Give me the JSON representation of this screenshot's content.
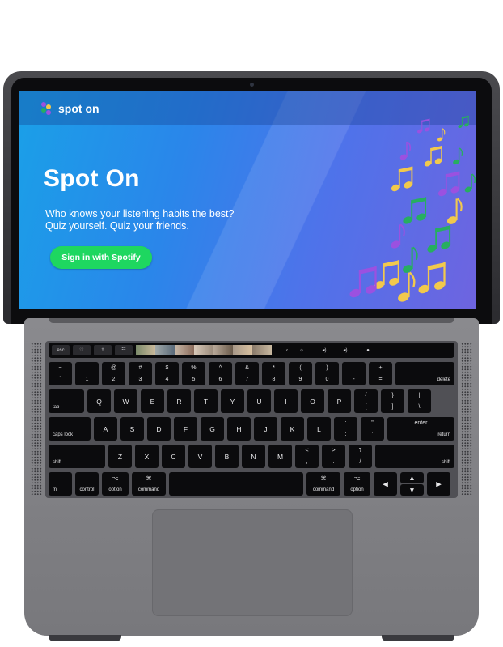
{
  "app": {
    "logo_text": "spot on",
    "title": "Spot On",
    "subtitle_lines": [
      "Who knows your listening habits the best?",
      "Quiz yourself. Quiz your friends."
    ],
    "signin_label": "Sign in with Spotify",
    "colors": {
      "accent": "#1ed760",
      "note_yellow": "#f2c94c",
      "note_green": "#27ae60",
      "note_purple": "#9b51e0"
    }
  },
  "touchbar": {
    "left_buttons": [
      "esc",
      "heart-icon",
      "share-icon",
      "sliders-icon"
    ],
    "right_buttons": [
      "chevron-left-icon",
      "brightness-icon",
      "volume-icon",
      "mute-icon",
      "siri-icon"
    ]
  },
  "keyboard": {
    "row1": [
      {
        "u": "~",
        "d": "`"
      },
      {
        "u": "!",
        "d": "1"
      },
      {
        "u": "@",
        "d": "2"
      },
      {
        "u": "#",
        "d": "3"
      },
      {
        "u": "$",
        "d": "4"
      },
      {
        "u": "%",
        "d": "5"
      },
      {
        "u": "^",
        "d": "6"
      },
      {
        "u": "&",
        "d": "7"
      },
      {
        "u": "*",
        "d": "8"
      },
      {
        "u": "(",
        "d": "9"
      },
      {
        "u": ")",
        "d": "0"
      },
      {
        "u": "—",
        "d": "-"
      },
      {
        "u": "+",
        "d": "="
      }
    ],
    "delete_label": "delete",
    "tab_label": "tab",
    "row2": [
      "Q",
      "W",
      "E",
      "R",
      "T",
      "Y",
      "U",
      "I",
      "O",
      "P"
    ],
    "row2_tail": [
      {
        "u": "{",
        "d": "["
      },
      {
        "u": "}",
        "d": "]"
      },
      {
        "u": "|",
        "d": "\\"
      }
    ],
    "caps_label": "caps lock",
    "row3": [
      "A",
      "S",
      "D",
      "F",
      "G",
      "H",
      "J",
      "K",
      "L"
    ],
    "row3_tail": [
      {
        "u": ":",
        "d": ";"
      },
      {
        "u": "\"",
        "d": "'"
      }
    ],
    "enter_top": "enter",
    "return_label": "return",
    "shift_label": "shift",
    "row4": [
      "Z",
      "X",
      "C",
      "V",
      "B",
      "N",
      "M"
    ],
    "row4_tail": [
      {
        "u": "<",
        "d": ","
      },
      {
        "u": ">",
        "d": "."
      },
      {
        "u": "?",
        "d": "/"
      }
    ],
    "fn_label": "fn",
    "control_label": "control",
    "option_label": "option",
    "command_label": "command",
    "command_symbol": "⌘",
    "option_symbol": "⌥",
    "arrows": {
      "up": "▲",
      "down": "▼",
      "left": "◀",
      "right": "▶"
    }
  }
}
